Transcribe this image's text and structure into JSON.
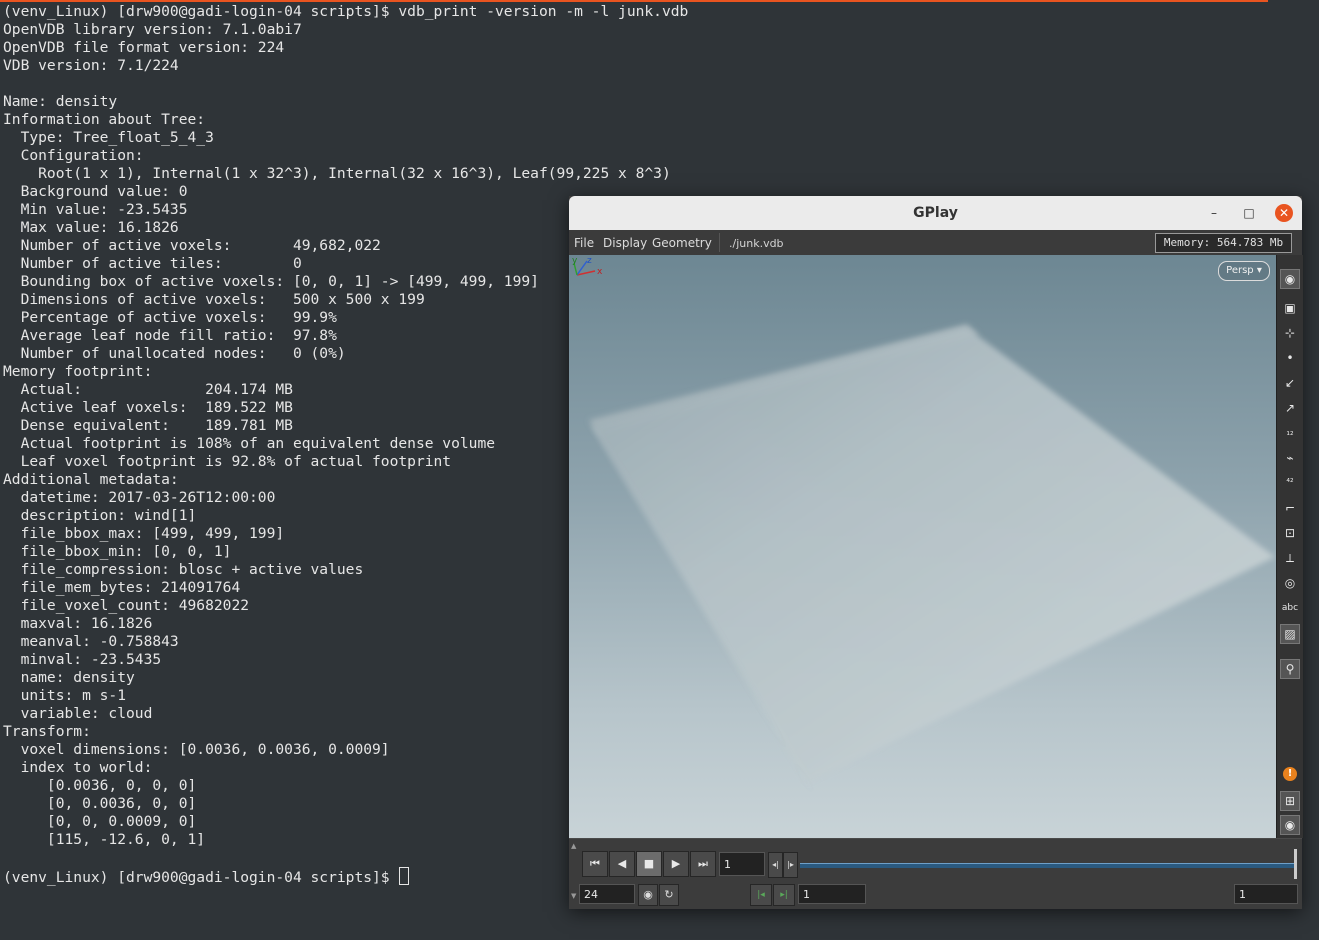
{
  "terminal": {
    "lines": [
      "(venv_Linux) [drw900@gadi-login-04 scripts]$ vdb_print -version -m -l junk.vdb",
      "OpenVDB library version: 7.1.0abi7",
      "OpenVDB file format version: 224",
      "VDB version: 7.1/224",
      "",
      "Name: density",
      "Information about Tree:",
      "  Type: Tree_float_5_4_3",
      "  Configuration:",
      "    Root(1 x 1), Internal(1 x 32^3), Internal(32 x 16^3), Leaf(99,225 x 8^3)",
      "  Background value: 0",
      "  Min value: -23.5435",
      "  Max value: 16.1826",
      "  Number of active voxels:       49,682,022",
      "  Number of active tiles:        0",
      "  Bounding box of active voxels: [0, 0, 1] -> [499, 499, 199]",
      "  Dimensions of active voxels:   500 x 500 x 199",
      "  Percentage of active voxels:   99.9%",
      "  Average leaf node fill ratio:  97.8%",
      "  Number of unallocated nodes:   0 (0%)",
      "Memory footprint:",
      "  Actual:              204.174 MB",
      "  Active leaf voxels:  189.522 MB",
      "  Dense equivalent:    189.781 MB",
      "  Actual footprint is 108% of an equivalent dense volume",
      "  Leaf voxel footprint is 92.8% of actual footprint",
      "Additional metadata:",
      "  datetime: 2017-03-26T12:00:00",
      "  description: wind[1]",
      "  file_bbox_max: [499, 499, 199]",
      "  file_bbox_min: [0, 0, 1]",
      "  file_compression: blosc + active values",
      "  file_mem_bytes: 214091764",
      "  file_voxel_count: 49682022",
      "  maxval: 16.1826",
      "  meanval: -0.758843",
      "  minval: -23.5435",
      "  name: density",
      "  units: m s-1",
      "  variable: cloud",
      "Transform:",
      "  voxel dimensions: [0.0036, 0.0036, 0.0009]",
      "  index to world:",
      "     [0.0036, 0, 0, 0]",
      "     [0, 0.0036, 0, 0]",
      "     [0, 0, 0.0009, 0]",
      "     [115, -12.6, 0, 1]",
      "",
      "(venv_Linux) [drw900@gadi-login-04 scripts]$ "
    ]
  },
  "gplay": {
    "title": "GPlay",
    "controls": {
      "minimize": "–",
      "maximize": "□",
      "close": "✕"
    },
    "menu": {
      "file": "File",
      "display": "Display",
      "geometry": "Geometry"
    },
    "file_path": "./junk.vdb",
    "memory": "Memory: 564.783 Mb",
    "persp_label": "Persp ▾",
    "axis": {
      "x": "x",
      "y": "y",
      "z": "z"
    },
    "sidebar_icons": [
      {
        "name": "camera-icon",
        "glyph": "◉"
      },
      {
        "name": "shaded-cube-icon",
        "glyph": "▣"
      },
      {
        "name": "display-options-icon",
        "glyph": "⊹"
      },
      {
        "name": "point-icon",
        "glyph": "•"
      },
      {
        "name": "vector-icon",
        "glyph": "↙"
      },
      {
        "name": "normal-icon",
        "glyph": "↗"
      },
      {
        "name": "point-numbers-icon",
        "glyph": "₁₂"
      },
      {
        "name": "brush-icon",
        "glyph": "⌁"
      },
      {
        "name": "prim-numbers-icon",
        "glyph": "⁴²"
      },
      {
        "name": "guide-icon",
        "glyph": "⌐"
      },
      {
        "name": "bounding-box-icon",
        "glyph": "⊡"
      },
      {
        "name": "origin-icon",
        "glyph": "⟂"
      },
      {
        "name": "ghost-icon",
        "glyph": "◎"
      },
      {
        "name": "text-label-icon",
        "glyph": "abc"
      },
      {
        "name": "background-image-icon",
        "glyph": "▨"
      },
      {
        "name": "location-pin-icon",
        "glyph": "⚲"
      },
      {
        "name": "warning-icon",
        "glyph": "!"
      },
      {
        "name": "grid-layout-icon",
        "glyph": "⊞"
      },
      {
        "name": "eye-icon",
        "glyph": "◉"
      }
    ],
    "playbar": {
      "first": "⏮",
      "prev": "◀",
      "stop": "■",
      "play": "▶",
      "last": "⏭",
      "current_frame": "1",
      "step_back": "◂|",
      "step_fwd": "|▸",
      "fps": "24",
      "realtime": "◉",
      "loop": "↻",
      "range_start_btn": "|◂",
      "range_end_btn": "▸|",
      "start_frame": "1",
      "end_frame": "1"
    }
  }
}
